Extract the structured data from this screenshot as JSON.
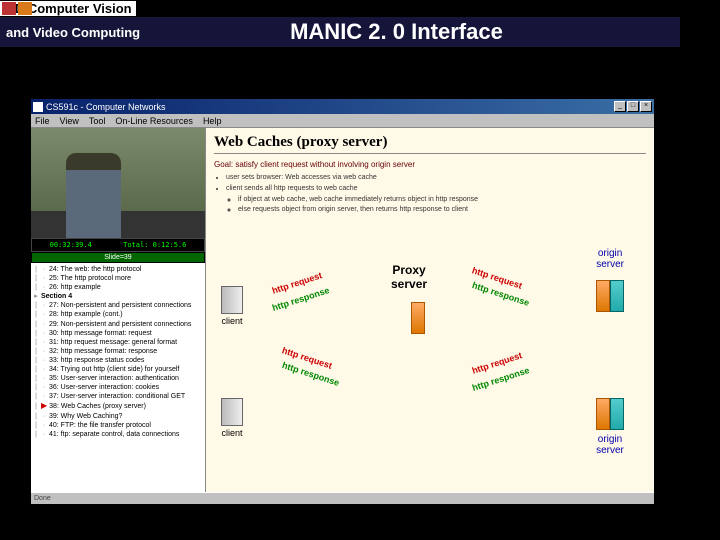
{
  "header": {
    "line1": "3 D Computer Vision",
    "line2": "and Video Computing",
    "pageTitle": "MANIC 2. 0 Interface"
  },
  "window": {
    "title": "CS591c - Computer Networks",
    "btns": {
      "min": "_",
      "max": "□",
      "close": "×"
    }
  },
  "menubar": [
    "File",
    "View",
    "Tool",
    "On-Line Resources",
    "Help"
  ],
  "video": {
    "timecode": "00:32:39.4",
    "total": "Total: 0:12:5.6",
    "slideInd": "Slide=39"
  },
  "outline": [
    {
      "num": "24",
      "text": "The web: the http protocol",
      "sel": false
    },
    {
      "num": "25",
      "text": "The http protocol more",
      "sel": false
    },
    {
      "num": "26",
      "text": "http example",
      "sel": false
    },
    {
      "hdr": "Section 4",
      "sel": false
    },
    {
      "num": "27",
      "text": "Non-persistent and persistent connections",
      "sel": false
    },
    {
      "num": "28",
      "text": "http example (cont.)",
      "sel": false
    },
    {
      "num": "29",
      "text": "Non-persistent and persistent connections",
      "sel": false
    },
    {
      "num": "30",
      "text": "http message format: request",
      "sel": false
    },
    {
      "num": "31",
      "text": "http request message: general format",
      "sel": false
    },
    {
      "num": "32",
      "text": "http message format: response",
      "sel": false
    },
    {
      "num": "33",
      "text": "http response status codes",
      "sel": false
    },
    {
      "num": "34",
      "text": "Trying out http (client side) for yourself",
      "sel": false
    },
    {
      "num": "35",
      "text": "User-server interaction: authentication",
      "sel": false
    },
    {
      "num": "36",
      "text": "User-server interaction: cookies",
      "sel": false
    },
    {
      "num": "37",
      "text": "User-server interaction: conditional GET",
      "sel": false
    },
    {
      "num": "38",
      "text": "Web Caches (proxy server)",
      "sel": true
    },
    {
      "num": "39",
      "text": "Why Web Caching?",
      "sel": false
    },
    {
      "num": "40",
      "text": "FTP: the file transfer protocol",
      "sel": false
    },
    {
      "num": "41",
      "text": "ftp: separate control, data connections",
      "sel": false
    }
  ],
  "statusbar": "Done",
  "slide": {
    "title": "Web Caches (proxy server)",
    "goal": "Goal: satisfy client request without involving origin server",
    "bullets": [
      "user sets browser: Web accesses via web cache",
      "client sends all http requests to web cache",
      "if object at web cache, web cache immediately returns object in http response",
      "else requests object from origin server, then returns http response to client"
    ],
    "labels": {
      "client1": "client",
      "client2": "client",
      "proxy": "Proxy",
      "server": "server",
      "origin1": "origin\nserver",
      "origin2": "origin\nserver",
      "httpReq": "http request",
      "httpResp": "http response"
    }
  }
}
